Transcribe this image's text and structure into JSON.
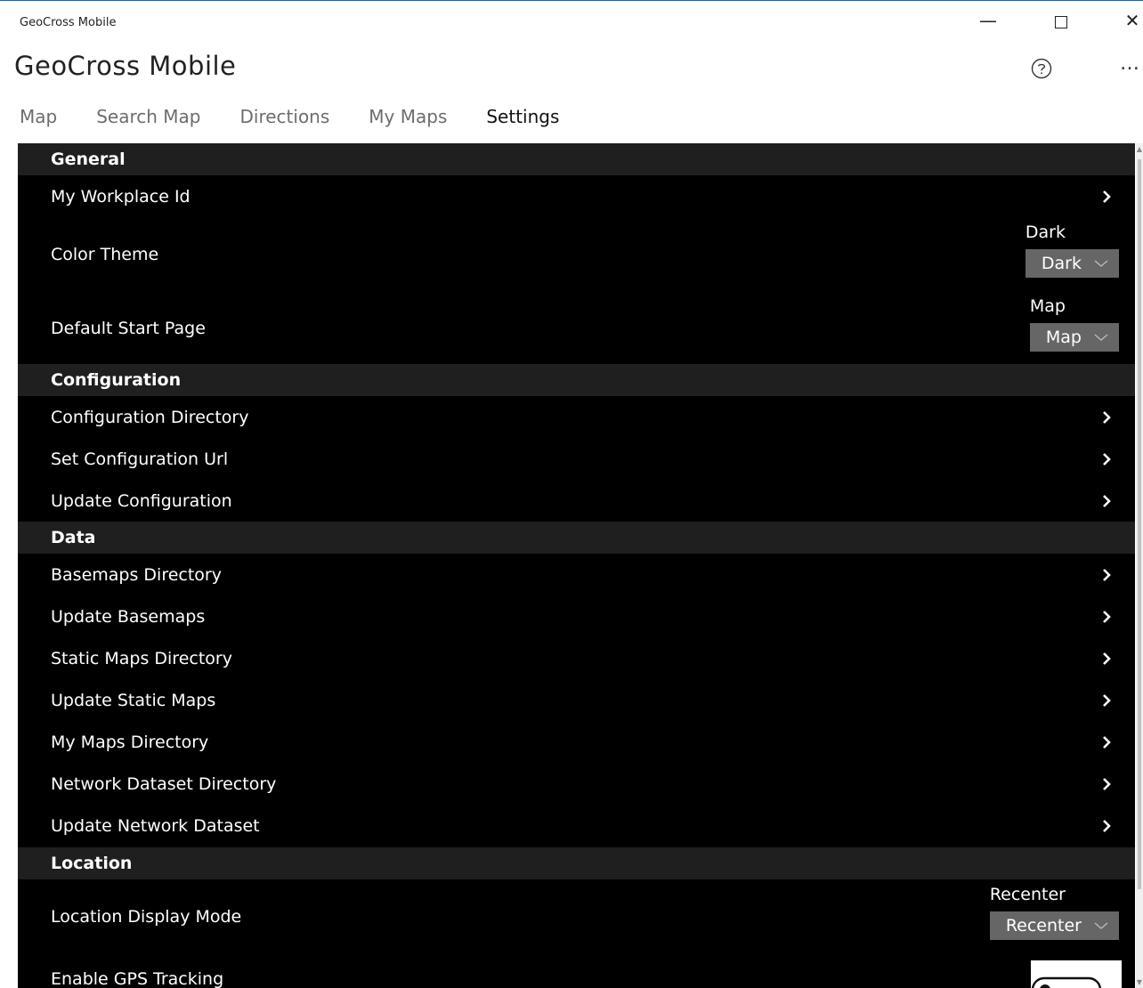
{
  "window": {
    "title": "GeoCross Mobile",
    "minimize_glyph": "—",
    "close_glyph": "✕"
  },
  "app": {
    "title": "GeoCross Mobile",
    "help_icon": "help-circle-icon",
    "more_glyph": "…"
  },
  "tabs": [
    {
      "label": "Map"
    },
    {
      "label": "Search Map"
    },
    {
      "label": "Directions"
    },
    {
      "label": "My Maps"
    },
    {
      "label": "Settings"
    }
  ],
  "active_tab": "Settings",
  "sections": {
    "general": {
      "header": "General",
      "workplace_id": "My Workplace Id",
      "color_theme": {
        "label": "Color Theme",
        "caption": "Dark",
        "value": "Dark"
      },
      "start_page": {
        "label": "Default Start Page",
        "caption": "Map",
        "value": "Map"
      }
    },
    "configuration": {
      "header": "Configuration",
      "items": [
        "Configuration Directory",
        "Set Configuration Url",
        "Update Configuration"
      ]
    },
    "data": {
      "header": "Data",
      "items": [
        "Basemaps Directory",
        "Update Basemaps",
        "Static Maps Directory",
        "Update Static Maps",
        "My Maps Directory",
        "Network Dataset Directory",
        "Update Network Dataset"
      ]
    },
    "location": {
      "header": "Location",
      "display_mode": {
        "label": "Location Display Mode",
        "caption": "Recenter",
        "value": "Recenter"
      },
      "gps": {
        "label": "Enable GPS Tracking",
        "on": false
      }
    }
  },
  "colors": {
    "panel_bg": "#000000",
    "section_header_bg": "#1f1f1f",
    "select_bg": "#666666",
    "tab_inactive": "#6d6d6d",
    "tab_active": "#111111"
  }
}
